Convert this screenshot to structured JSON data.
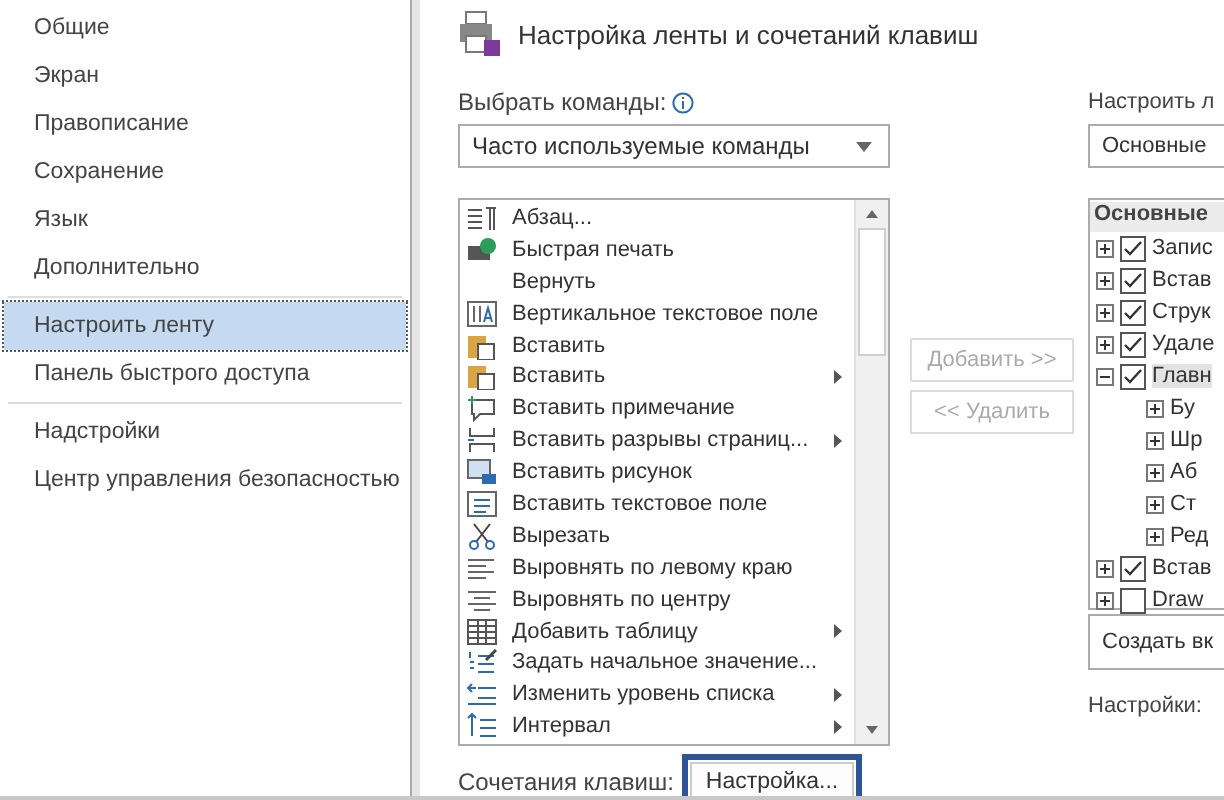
{
  "sidebar": {
    "items": [
      {
        "label": "Общие",
        "selected": false,
        "divider_after": false
      },
      {
        "label": "Экран",
        "selected": false,
        "divider_after": false
      },
      {
        "label": "Правописание",
        "selected": false,
        "divider_after": false
      },
      {
        "label": "Сохранение",
        "selected": false,
        "divider_after": false
      },
      {
        "label": "Язык",
        "selected": false,
        "divider_after": false
      },
      {
        "label": "Дополнительно",
        "selected": false,
        "divider_after": true
      },
      {
        "label": "Настроить ленту",
        "selected": true,
        "divider_after": false
      },
      {
        "label": "Панель быстрого доступа",
        "selected": false,
        "divider_after": true
      },
      {
        "label": "Надстройки",
        "selected": false,
        "divider_after": false
      },
      {
        "label": "Центр управления безопасностью",
        "selected": false,
        "divider_after": false
      }
    ]
  },
  "main": {
    "title": "Настройка ленты и сочетаний клавиш",
    "commands_label": "Выбрать команды:",
    "commands_dropdown": "Часто используемые команды",
    "commands": [
      {
        "label": "Абзац...",
        "submenu": false
      },
      {
        "label": "Быстрая печать",
        "submenu": false
      },
      {
        "label": "Вернуть",
        "submenu": false
      },
      {
        "label": "Вертикальное текстовое поле",
        "submenu": false
      },
      {
        "label": "Вставить",
        "submenu": false
      },
      {
        "label": "Вставить",
        "submenu": true
      },
      {
        "label": "Вставить примечание",
        "submenu": false
      },
      {
        "label": "Вставить разрывы страниц...",
        "submenu": true
      },
      {
        "label": "Вставить рисунок",
        "submenu": false
      },
      {
        "label": "Вставить текстовое поле",
        "submenu": false
      },
      {
        "label": "Вырезать",
        "submenu": false
      },
      {
        "label": "Выровнять по левому краю",
        "submenu": false
      },
      {
        "label": "Выровнять по центру",
        "submenu": false
      },
      {
        "label": "Добавить таблицу",
        "submenu": true
      },
      {
        "label": "Задать начальное значение...",
        "submenu": false
      },
      {
        "label": "Изменить уровень списка",
        "submenu": true
      },
      {
        "label": "Интервал",
        "submenu": true
      }
    ],
    "add_button": {
      "label": "Добавить >>",
      "disabled": true
    },
    "remove_button": {
      "label": "<< Удалить",
      "disabled": true
    },
    "shortcuts_label": "Сочетания клавиш:",
    "shortcuts_button": "Настройка..."
  },
  "ribbon": {
    "label": "Настроить л",
    "dropdown": "Основные",
    "tree_header": "Основные",
    "tabs": [
      {
        "label": "Запис",
        "checked": true,
        "expanded": false
      },
      {
        "label": "Встав",
        "checked": true,
        "expanded": false
      },
      {
        "label": "Струк",
        "checked": true,
        "expanded": false
      },
      {
        "label": "Удале",
        "checked": true,
        "expanded": false
      },
      {
        "label": "Главн",
        "checked": true,
        "expanded": true,
        "children": [
          {
            "label": "Бу"
          },
          {
            "label": "Шр"
          },
          {
            "label": "Аб"
          },
          {
            "label": "Ст"
          },
          {
            "label": "Ред"
          }
        ]
      },
      {
        "label": "Встав",
        "checked": true,
        "expanded": false
      },
      {
        "label": "Draw",
        "checked": false,
        "expanded": false
      }
    ],
    "new_tab_button": "Создать вк",
    "settings_label": "Настройки:"
  }
}
